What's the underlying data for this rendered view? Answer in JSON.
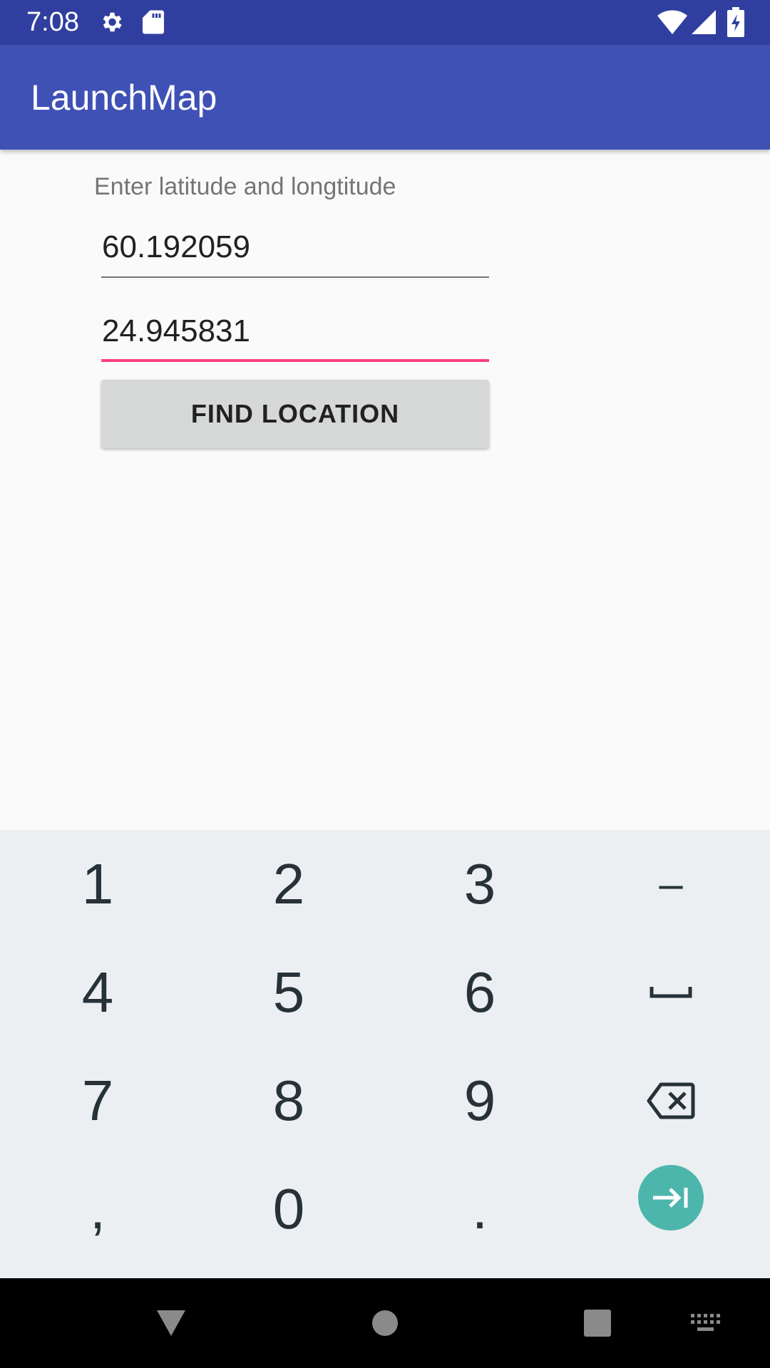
{
  "status_bar": {
    "time": "7:08",
    "icons": [
      "gear-icon",
      "sd-card-icon",
      "wifi-icon",
      "cell-signal-icon",
      "battery-charging-icon"
    ]
  },
  "app_bar": {
    "title": "LaunchMap",
    "color": "#3F51B5"
  },
  "form": {
    "prompt": "Enter latitude and longtitude",
    "latitude_value": "60.192059",
    "longitude_value": "24.945831",
    "find_button_label": "FIND LOCATION",
    "focused_field": "longitude",
    "accent_color": "#FF4081"
  },
  "keyboard": {
    "keys": {
      "k1": "1",
      "k2": "2",
      "k3": "3",
      "minus": "–",
      "k4": "4",
      "k5": "5",
      "k6": "6",
      "k7": "7",
      "k8": "8",
      "k9": "9",
      "comma": ",",
      "k0": "0",
      "period": "."
    },
    "special_icons": [
      "space-icon",
      "backspace-icon",
      "next-field-icon"
    ],
    "enter_color": "#4DB6AC"
  },
  "nav_bar": {
    "buttons": [
      "back-icon",
      "home-icon",
      "recents-icon",
      "keyboard-switch-icon"
    ]
  }
}
